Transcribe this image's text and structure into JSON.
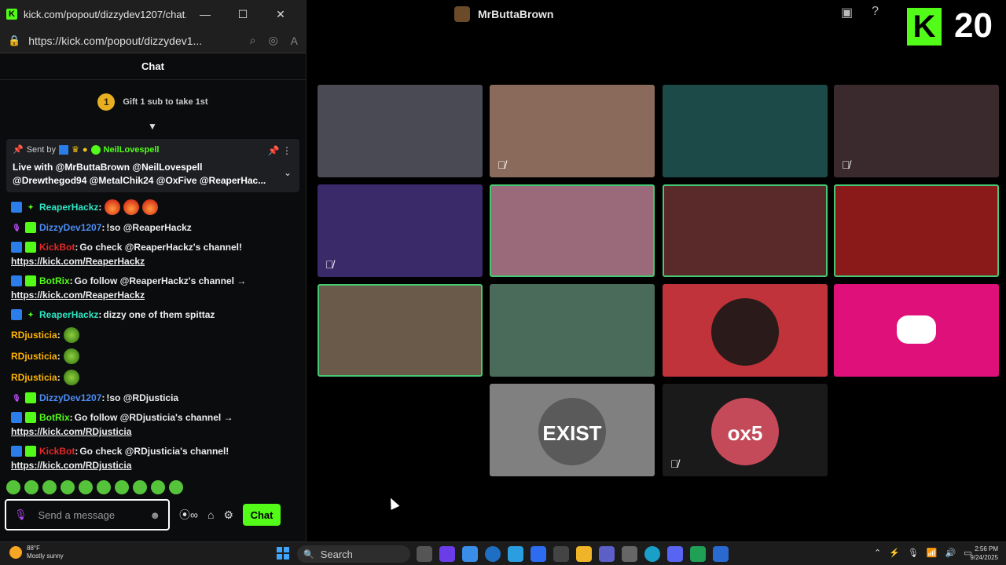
{
  "popout": {
    "title": "kick.com/popout/dizzydev1207/chat...",
    "url": "https://kick.com/popout/dizzydev1...",
    "chat_header": "Chat",
    "gift_badge": "1",
    "gift_text": "Gift 1 sub to take 1st",
    "pinned": {
      "sent_by": "Sent by",
      "user": "NeilLovespell",
      "message": "Live with @MrButtaBrown @NeilLovespell @Drewthegod94 @MetalChik24 @OxFive @ReaperHac..."
    },
    "messages": [
      {
        "user": "ReaperHackz",
        "user_color": "cyan",
        "text": "",
        "emotes": 3,
        "emote_kind": "fire",
        "link": ""
      },
      {
        "user": "DizzyDev1207",
        "user_color": "blue",
        "text": "!so @ReaperHackz",
        "emotes": 0,
        "emote_kind": "",
        "link": ""
      },
      {
        "user": "KickBot",
        "user_color": "red",
        "text": "Go check @ReaperHackz's channel!",
        "emotes": 0,
        "emote_kind": "",
        "link": "https://kick.com/ReaperHackz"
      },
      {
        "user": "BotRix",
        "user_color": "green",
        "text": "Go follow @ReaperHackz's channel →",
        "emotes": 0,
        "emote_kind": "",
        "link": "https://kick.com/ReaperHackz"
      },
      {
        "user": "ReaperHackz",
        "user_color": "cyan",
        "text": "dizzy one of them spittaz",
        "emotes": 0,
        "emote_kind": "",
        "link": ""
      },
      {
        "user": "RDjusticia",
        "user_color": "orange",
        "text": "",
        "emotes": 1,
        "emote_kind": "pepe",
        "link": ""
      },
      {
        "user": "RDjusticia",
        "user_color": "orange",
        "text": "",
        "emotes": 1,
        "emote_kind": "pepe",
        "link": ""
      },
      {
        "user": "RDjusticia",
        "user_color": "orange",
        "text": "",
        "emotes": 1,
        "emote_kind": "pepe",
        "link": ""
      },
      {
        "user": "DizzyDev1207",
        "user_color": "blue",
        "text": "!so @RDjusticia",
        "emotes": 0,
        "emote_kind": "",
        "link": ""
      },
      {
        "user": "BotRix",
        "user_color": "green",
        "text": "Go follow @RDjusticia's channel →",
        "emotes": 0,
        "emote_kind": "",
        "link": "https://kick.com/RDjusticia"
      },
      {
        "user": "KickBot",
        "user_color": "red",
        "text": "Go check @RDjusticia's channel!",
        "emotes": 0,
        "emote_kind": "",
        "link": "https://kick.com/RDjusticia"
      }
    ],
    "input_placeholder": "Send a message",
    "chat_button": "Chat"
  },
  "stream": {
    "streamer_name": "MrButtaBrown",
    "viewer_count": "20",
    "kick_logo": "K",
    "tiles": [
      {
        "color": "#4a4a55",
        "active": false,
        "muted": false,
        "label": ""
      },
      {
        "color": "#8a6a5a",
        "active": false,
        "muted": true,
        "label": ""
      },
      {
        "color": "#1c4a48",
        "active": false,
        "muted": false,
        "label": ""
      },
      {
        "color": "#3a2a2e",
        "active": false,
        "muted": true,
        "label": ""
      },
      {
        "color": "#3a2a6a",
        "active": false,
        "muted": true,
        "label": ""
      },
      {
        "color": "#9a6a7a",
        "active": true,
        "muted": false,
        "label": ""
      },
      {
        "color": "#5a2a2a",
        "active": true,
        "muted": false,
        "label": ""
      },
      {
        "color": "#8a1a1a",
        "active": true,
        "muted": false,
        "label": ""
      },
      {
        "color": "#6a5a4a",
        "active": true,
        "muted": false,
        "label": ""
      },
      {
        "color": "#4a6a5a",
        "active": false,
        "muted": false,
        "label": ""
      },
      {
        "color": "#c0333a",
        "active": false,
        "muted": false,
        "label": ""
      },
      {
        "color": "#e0107a",
        "active": false,
        "muted": false,
        "label": ""
      },
      {
        "color": "#808080",
        "active": false,
        "muted": false,
        "label": "EXIST"
      },
      {
        "color": "#1a1a1a",
        "active": false,
        "muted": true,
        "label": "ox5"
      }
    ]
  },
  "taskbar": {
    "temp": "88°F",
    "weather": "Mostly sunny",
    "search_placeholder": "Search",
    "time": "2:56 PM",
    "date": "9/24/2025"
  }
}
